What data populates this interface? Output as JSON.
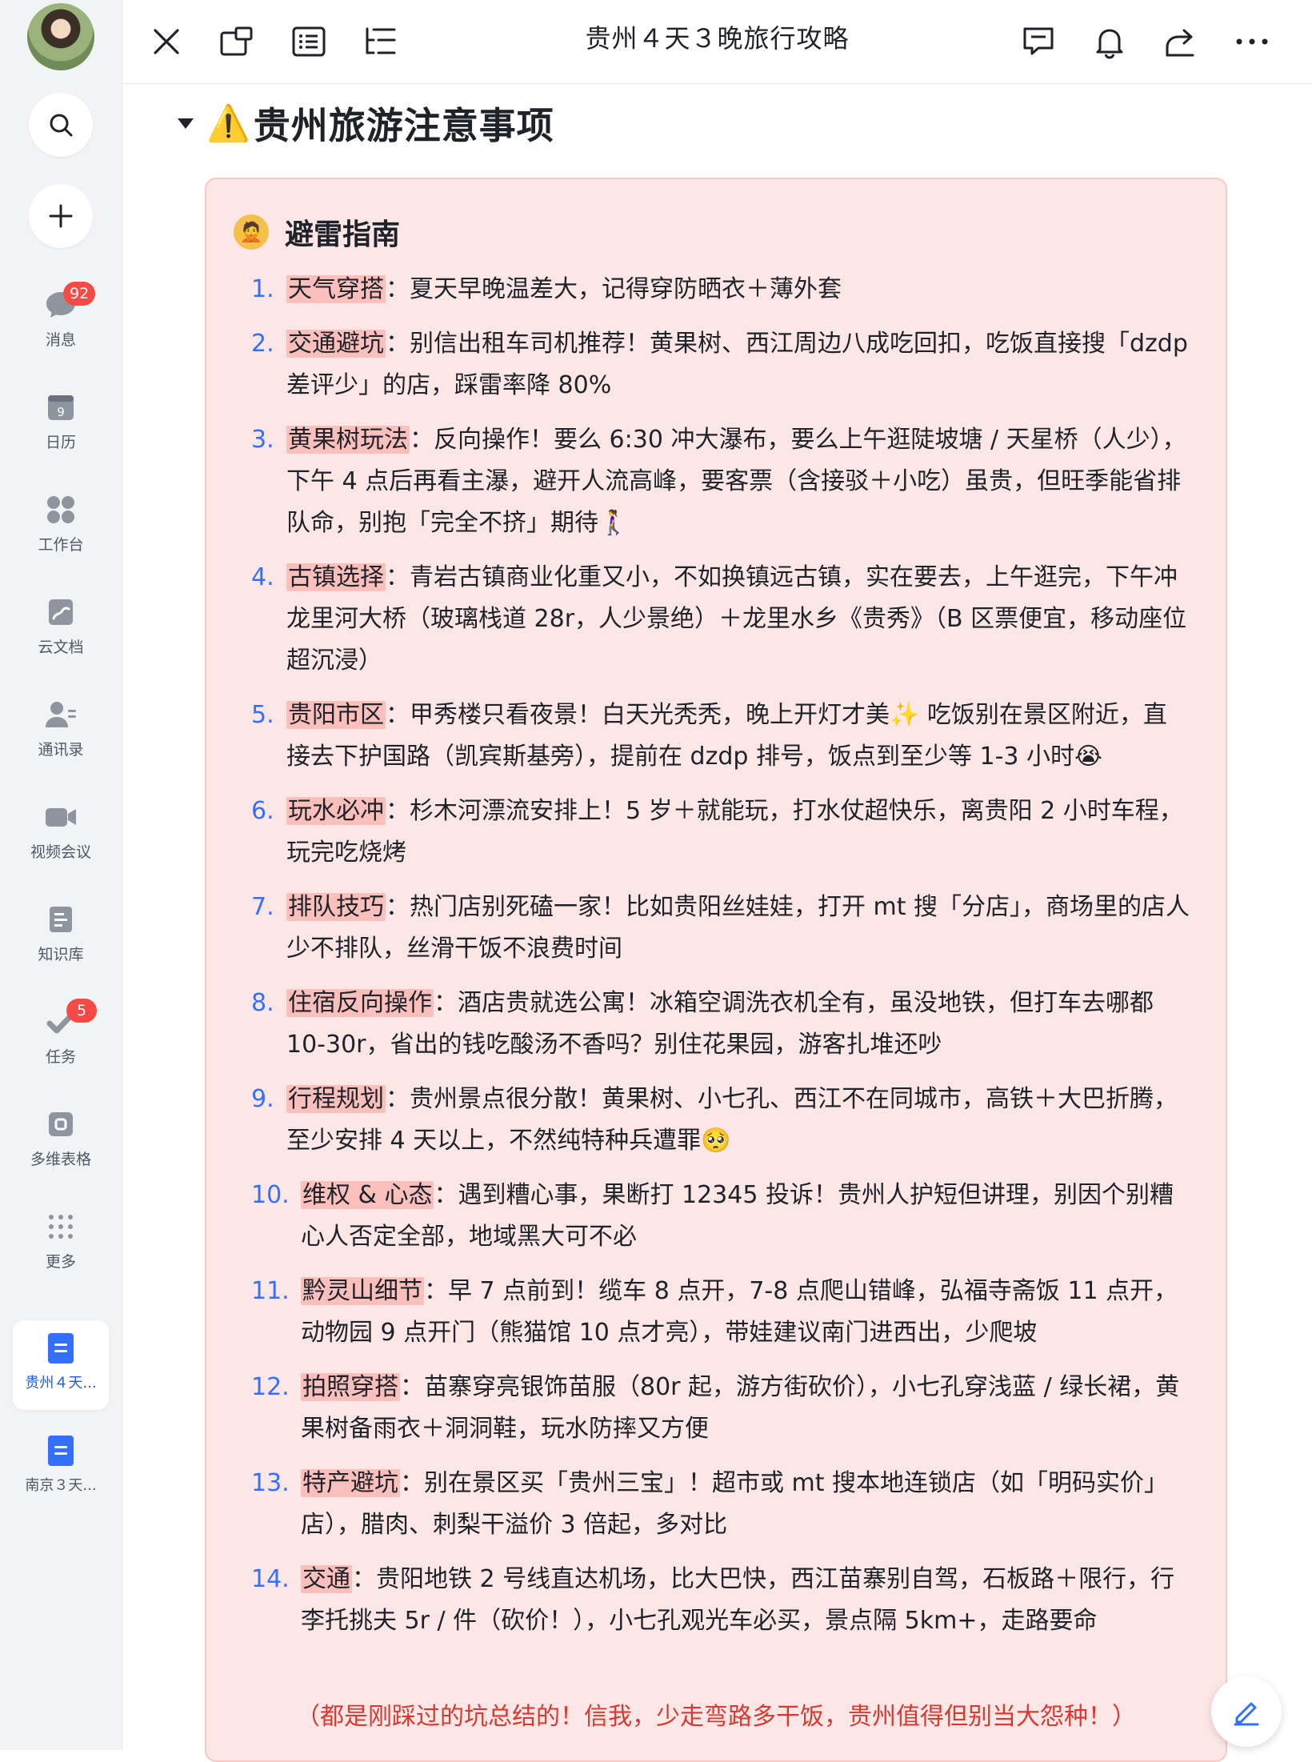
{
  "sidebar": {
    "search_icon": "search-icon",
    "add_icon": "plus-icon",
    "items": [
      {
        "label": "消息",
        "icon": "chat-bubble-icon",
        "badge": "92"
      },
      {
        "label": "日历",
        "icon": "calendar-icon",
        "icon_text": "9"
      },
      {
        "label": "工作台",
        "icon": "apps-grid-icon"
      },
      {
        "label": "云文档",
        "icon": "cloud-doc-icon"
      },
      {
        "label": "通讯录",
        "icon": "contacts-icon"
      },
      {
        "label": "视频会议",
        "icon": "video-camera-icon"
      },
      {
        "label": "知识库",
        "icon": "knowledge-base-icon"
      },
      {
        "label": "任务",
        "icon": "task-check-icon",
        "badge": "5"
      },
      {
        "label": "多维表格",
        "icon": "base-table-icon"
      },
      {
        "label": "更多",
        "icon": "more-dots-icon"
      }
    ],
    "open_docs": [
      {
        "label": "贵州４天...",
        "active": true
      },
      {
        "label": "南京３天...",
        "active": false
      }
    ]
  },
  "topbar": {
    "title": "贵州４天３晚旅行攻略"
  },
  "content": {
    "section_heading": "贵州旅游注意事项",
    "warning_emoji": "⚠️",
    "callout": {
      "emoji": "🙅",
      "title": "避雷指南",
      "items": [
        {
          "num": "1.",
          "tag": "天气穿搭",
          "text": "：夏天早晚温差大，记得穿防晒衣＋薄外套"
        },
        {
          "num": "2.",
          "tag": "交通避坑",
          "text": "：别信出租车司机推荐！黄果树、西江周边八成吃回扣，吃饭直接搜「dzdp 差评少」的店，踩雷率降 80%"
        },
        {
          "num": "3.",
          "tag": "黄果树玩法",
          "text": "：反向操作！要么 6:30 冲大瀑布，要么上午逛陡坡塘 / 天星桥（人少），下午 4 点后再看主瀑，避开人流高峰，要客票（含接驳＋小吃）虽贵，但旺季能省排队命，别抱「完全不挤」期待🚶‍♀️"
        },
        {
          "num": "4.",
          "tag": "古镇选择",
          "text": "：青岩古镇商业化重又小，不如换镇远古镇，实在要去，上午逛完，下午冲龙里河大桥（玻璃栈道 28r，人少景绝）＋龙里水乡《贵秀》（B 区票便宜，移动座位超沉浸）"
        },
        {
          "num": "5.",
          "tag": "贵阳市区",
          "text": "：甲秀楼只看夜景！白天光秃秃，晚上开灯才美✨ 吃饭别在景区附近，直接去下护国路（凯宾斯基旁），提前在 dzdp 排号，饭点到至少等 1-3 小时😭"
        },
        {
          "num": "6.",
          "tag": "玩水必冲",
          "text": "：杉木河漂流安排上！5 岁＋就能玩，打水仗超快乐，离贵阳 2 小时车程，玩完吃烧烤"
        },
        {
          "num": "7.",
          "tag": "排队技巧",
          "text": "：热门店别死磕一家！比如贵阳丝娃娃，打开 mt 搜「分店」，商场里的店人少不排队，丝滑干饭不浪费时间"
        },
        {
          "num": "8.",
          "tag": "住宿反向操作",
          "text": "：酒店贵就选公寓！冰箱空调洗衣机全有，虽没地铁，但打车去哪都 10-30r，省出的钱吃酸汤不香吗？别住花果园，游客扎堆还吵"
        },
        {
          "num": "9.",
          "tag": "行程规划",
          "text": "：贵州景点很分散！黄果树、小七孔、西江不在同城市，高铁＋大巴折腾，至少安排 4 天以上，不然纯特种兵遭罪🥺"
        },
        {
          "num": "10.",
          "tag": "维权 & 心态",
          "text": "：遇到糟心事，果断打 12345 投诉！贵州人护短但讲理，别因个别糟心人否定全部，地域黑大可不必"
        },
        {
          "num": "11.",
          "tag": "黔灵山细节",
          "text": "：早 7 点前到！缆车 8 点开，7-8 点爬山错峰，弘福寺斋饭 11 点开，动物园 9 点开门（熊猫馆 10 点才亮），带娃建议南门进西出，少爬坡"
        },
        {
          "num": "12.",
          "tag": "拍照穿搭",
          "text": "：苗寨穿亮银饰苗服（80r 起，游方街砍价），小七孔穿浅蓝 / 绿长裙，黄果树备雨衣＋洞洞鞋，玩水防摔又方便"
        },
        {
          "num": "13.",
          "tag": "特产避坑",
          "text": "：别在景区买「贵州三宝」！超市或 mt 搜本地连锁店（如「明码实价」店），腊肉、刺梨干溢价 3 倍起，多对比"
        },
        {
          "num": "14.",
          "tag": "交通",
          "text": "：贵阳地铁 2 号线直达机场，比大巴快，西江苗寨别自驾，石板路＋限行，行李托挑夫 5r / 件（砍价！），小七孔观光车必买，景点隔 5km+，走路要命"
        }
      ],
      "footer": "（都是刚踩过的坑总结的！信我，少走弯路多干饭，贵州值得但别当大怨种！）"
    }
  }
}
